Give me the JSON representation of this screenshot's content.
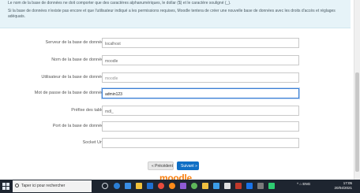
{
  "info": {
    "line1": "Le nom de la base de données ne doit comporter que des caractères alphanumériques, le dollar ($) et le caractère souligné (_).",
    "line2": "Si la base de données n'existe pas encore et que l'utilisateur indiqué a les permissions requises, Moodle tentera de créer une nouvelle base de données avec les droits d'accès et réglages adéquats."
  },
  "form": {
    "rows": [
      {
        "label": "Serveur de la base de données",
        "value": "localhost",
        "placeholder": ""
      },
      {
        "label": "Nom de la base de données",
        "value": "moodle",
        "placeholder": ""
      },
      {
        "label": "Utilisateur de la base de données",
        "value": "",
        "placeholder": "moodle"
      },
      {
        "label": "Mot de passe de la base de données",
        "value": "admin123",
        "placeholder": ""
      },
      {
        "label": "Préfixe des tables",
        "value": "mdl_",
        "placeholder": ""
      },
      {
        "label": "Port de la base de données",
        "value": "",
        "placeholder": ""
      },
      {
        "label": "Socket Unix",
        "value": "",
        "placeholder": ""
      }
    ]
  },
  "buttons": {
    "prev": "« Précédent",
    "next": "Suivant »"
  },
  "branding": {
    "logo_text": "moodle",
    "logo_color": "#f98012"
  },
  "taskbar": {
    "search_placeholder": "Taper ici pour rechercher",
    "tray_text": "^ ⌂ ENG",
    "clock_time": "17:05",
    "clock_date": "20/04/2021"
  },
  "colors": {
    "accent": "#0f6fc5",
    "info_bg": "#e6f3f8",
    "taskbar_bg": "#1e2530"
  }
}
